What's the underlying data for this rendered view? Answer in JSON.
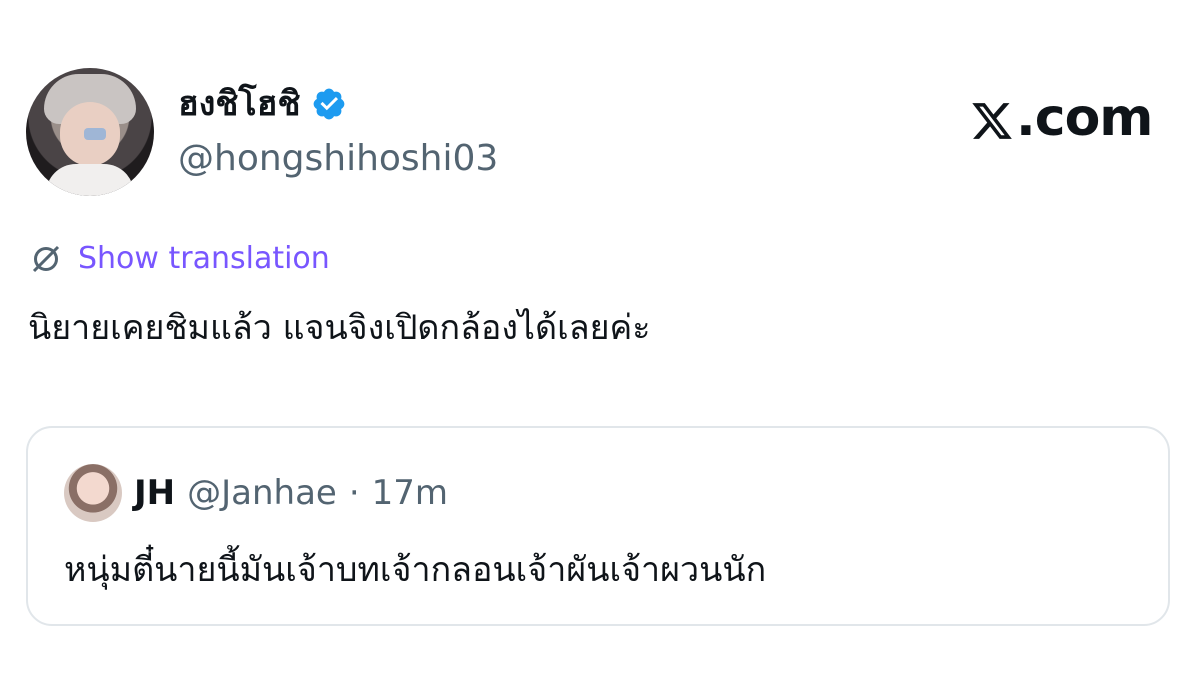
{
  "tweet": {
    "display_name": "ฮงชิโฮชิ",
    "handle": "@hongshihoshi03",
    "verified_icon": "verified-badge-icon",
    "show_translation": "Show translation",
    "text": "นิยายเคยชิมแล้ว แจนจิงเปิดกล้องได้เลยค่ะ"
  },
  "brand": {
    "suffix": ".com"
  },
  "quote": {
    "name": "JH",
    "handle": "@Janhae",
    "dot": "·",
    "time": "17m",
    "text": "หนุ่มตี๋นายนี้มันเจ้าบทเจ้ากลอนเจ้าผันเจ้าผวนนัก"
  },
  "colors": {
    "accent_purple": "#7856ff",
    "verified_blue": "#1d9bf0",
    "secondary_text": "#536471",
    "border": "#e1e6ea"
  }
}
